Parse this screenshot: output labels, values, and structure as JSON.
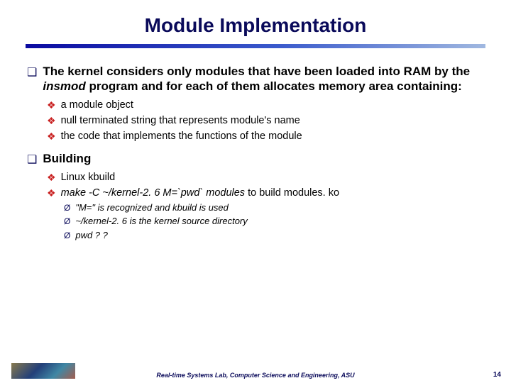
{
  "title": "Module Implementation",
  "l1": [
    {
      "text_parts": [
        "The kernel considers only modules that have been loaded into RAM by the ",
        {
          "i": "insmod"
        },
        " program and for each of them allocates memory area containing:"
      ],
      "l2": [
        {
          "text_parts": [
            "a module object"
          ]
        },
        {
          "text_parts": [
            "null terminated string that represents module's name"
          ]
        },
        {
          "text_parts": [
            "the code that implements the functions of the module"
          ]
        }
      ]
    },
    {
      "text_parts": [
        "Building"
      ],
      "l2": [
        {
          "text_parts": [
            "Linux kbuild"
          ]
        },
        {
          "text_parts": [
            {
              "i": "make -C ~/kernel-2. 6 M=`pwd` modules"
            },
            " to build modules. ko"
          ],
          "l3": [
            {
              "text_parts": [
                "\"M=\" is recognized and kbuild is used"
              ]
            },
            {
              "text_parts": [
                "~/kernel-2. 6 is the kernel source directory"
              ]
            },
            {
              "text_parts": [
                "pwd  ? ?"
              ]
            }
          ]
        }
      ]
    }
  ],
  "footer": "Real-time Systems Lab, Computer Science and Engineering, ASU",
  "page": "14"
}
